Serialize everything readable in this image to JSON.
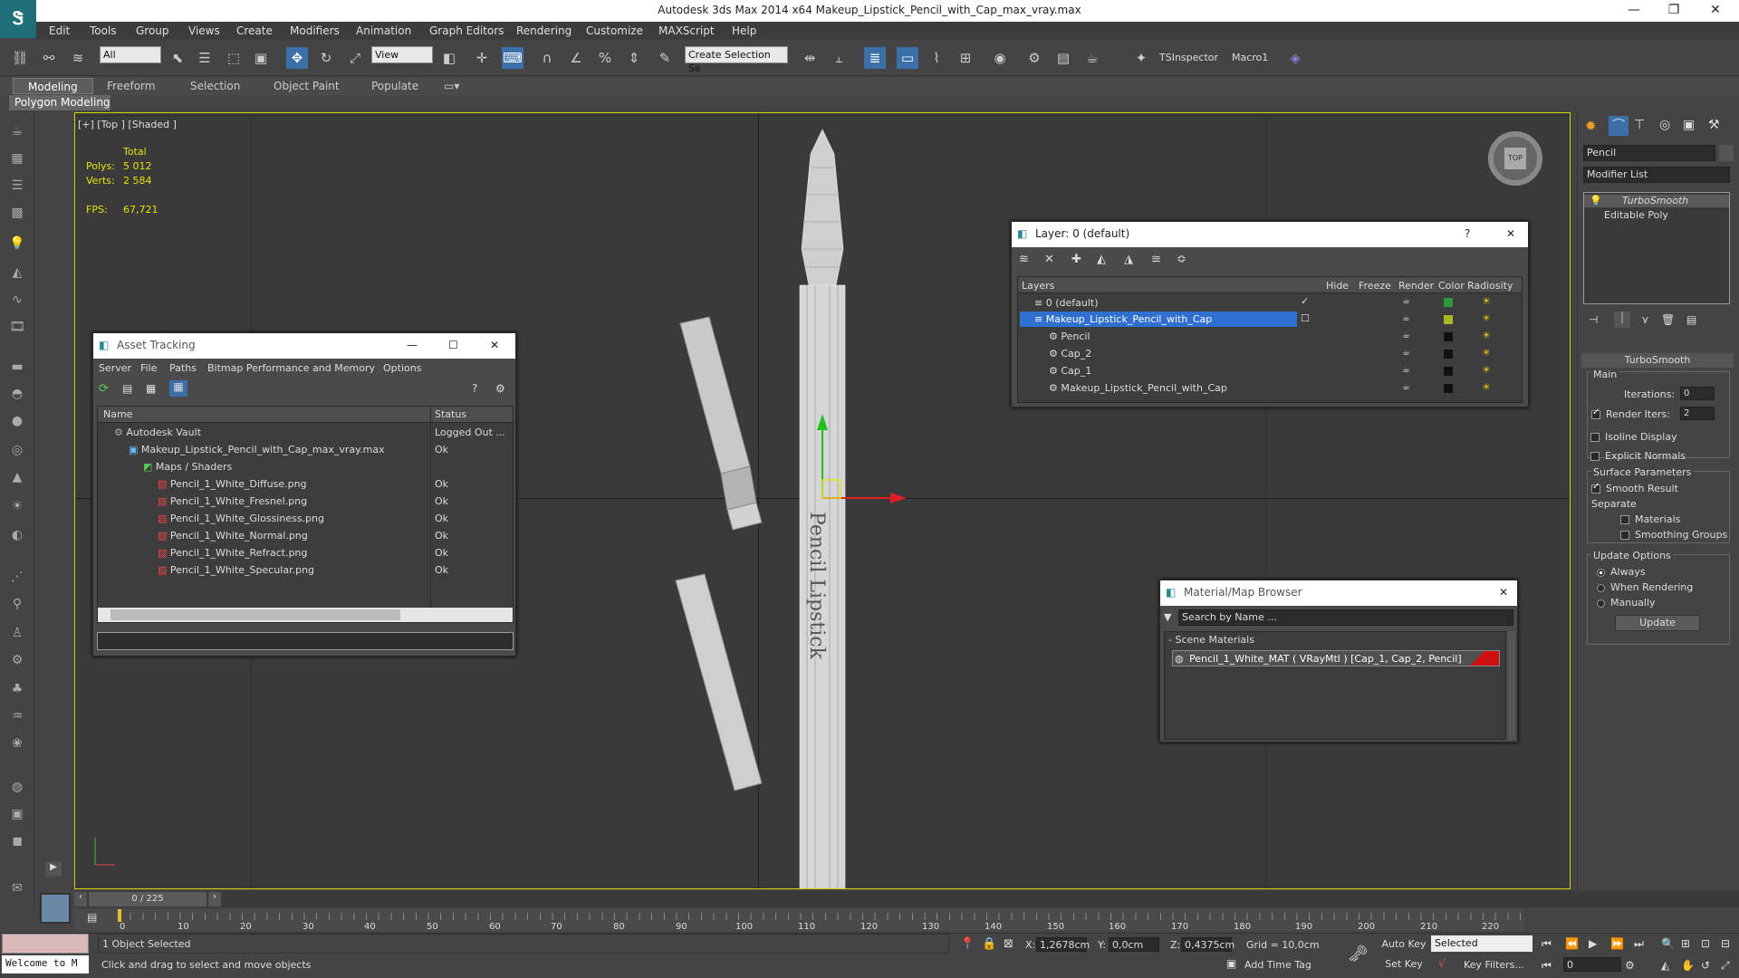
{
  "app": {
    "title": "Autodesk 3ds Max  2014 x64     Makeup_Lipstick_Pencil_with_Cap_max_vray.max"
  },
  "menu": [
    "Edit",
    "Tools",
    "Group",
    "Views",
    "Create",
    "Modifiers",
    "Animation",
    "Graph Editors",
    "Rendering",
    "Customize",
    "MAXScript",
    "Help"
  ],
  "toolbar": {
    "filter": "All",
    "refcoord": "View",
    "selset": "Create Selection Se",
    "ts": "TSInspector",
    "macro": "Macro1"
  },
  "ribbon": {
    "tabs": [
      "Modeling",
      "Freeform",
      "Selection",
      "Object Paint",
      "Populate"
    ],
    "sub": "Polygon Modeling"
  },
  "viewport": {
    "label": "[+] [Top ] [Shaded ]",
    "stats": {
      "total": "Total",
      "polys_label": "Polys:",
      "polys": "5 012",
      "verts_label": "Verts:",
      "verts": "2 584",
      "fps_label": "FPS:",
      "fps": "67,721"
    },
    "pencil_text": "Pencil Lipstick",
    "nav": "TOP"
  },
  "asset": {
    "title": "Asset Tracking",
    "menu": [
      "Server",
      "File",
      "Paths",
      "Bitmap Performance and Memory",
      "Options"
    ],
    "col_name": "Name",
    "col_status": "Status",
    "rows": [
      {
        "name": "Autodesk Vault",
        "status": "Logged Out ..."
      },
      {
        "name": "Makeup_Lipstick_Pencil_with_Cap_max_vray.max",
        "status": "Ok"
      },
      {
        "name": "Maps / Shaders",
        "status": ""
      },
      {
        "name": "Pencil_1_White_Diffuse.png",
        "status": "Ok"
      },
      {
        "name": "Pencil_1_White_Fresnel.png",
        "status": "Ok"
      },
      {
        "name": "Pencil_1_White_Glossiness.png",
        "status": "Ok"
      },
      {
        "name": "Pencil_1_White_Normal.png",
        "status": "Ok"
      },
      {
        "name": "Pencil_1_White_Refract.png",
        "status": "Ok"
      },
      {
        "name": "Pencil_1_White_Specular.png",
        "status": "Ok"
      }
    ]
  },
  "layer": {
    "title": "Layer: 0 (default)",
    "cols": [
      "Layers",
      "Hide",
      "Freeze",
      "Render",
      "Color",
      "Radiosity"
    ],
    "rows": [
      {
        "name": "0 (default)",
        "color": "#2a9a3a"
      },
      {
        "name": "Makeup_Lipstick_Pencil_with_Cap",
        "color": "#a8b820"
      },
      {
        "name": "Pencil",
        "color": "#111111"
      },
      {
        "name": "Cap_2",
        "color": "#111111"
      },
      {
        "name": "Cap_1",
        "color": "#111111"
      },
      {
        "name": "Makeup_Lipstick_Pencil_with_Cap",
        "color": "#111111"
      }
    ]
  },
  "material": {
    "title": "Material/Map Browser",
    "search": "Search by Name ...",
    "section": "Scene Materials",
    "item": "Pencil_1_White_MAT  ( VRayMtl )  [Cap_1, Cap_2, Pencil]"
  },
  "cmd": {
    "name": "Pencil",
    "modlist": "Modifier List",
    "stack": [
      "TurboSmooth",
      "Editable Poly"
    ],
    "rollout": "TurboSmooth",
    "main": "Main",
    "iter_label": "Iterations:",
    "iter": "0",
    "render_label": "Render Iters:",
    "render": "2",
    "isoline": "Isoline Display",
    "explicit": "Explicit Normals",
    "surface": "Surface Parameters",
    "smooth": "Smooth Result",
    "separate": "Separate",
    "materials": "Materials",
    "smoothgroups": "Smoothing Groups",
    "update_opts": "Update Options",
    "always": "Always",
    "whenrender": "When Rendering",
    "manually": "Manually",
    "update_btn": "Update"
  },
  "timeline": {
    "frame": "0 / 225",
    "ticks": [
      "0",
      "10",
      "20",
      "30",
      "40",
      "50",
      "60",
      "70",
      "80",
      "90",
      "100",
      "110",
      "120",
      "130",
      "140",
      "150",
      "160",
      "170",
      "180",
      "190",
      "200",
      "210",
      "220"
    ]
  },
  "status": {
    "welcome": "Welcome to M",
    "selected": "1 Object Selected",
    "hint": "Click and drag to select and move objects",
    "x": "1,2678cm",
    "y": "0,0cm",
    "z": "0,4375cm",
    "grid": "Grid = 10,0cm",
    "autokey": "Auto Key",
    "setkey": "Set Key",
    "keymode": "Selected",
    "keyfilters": "Key Filters...",
    "addtime": "Add Time Tag",
    "frame": "0",
    "xl": "X:",
    "yl": "Y:",
    "zl": "Z:"
  }
}
